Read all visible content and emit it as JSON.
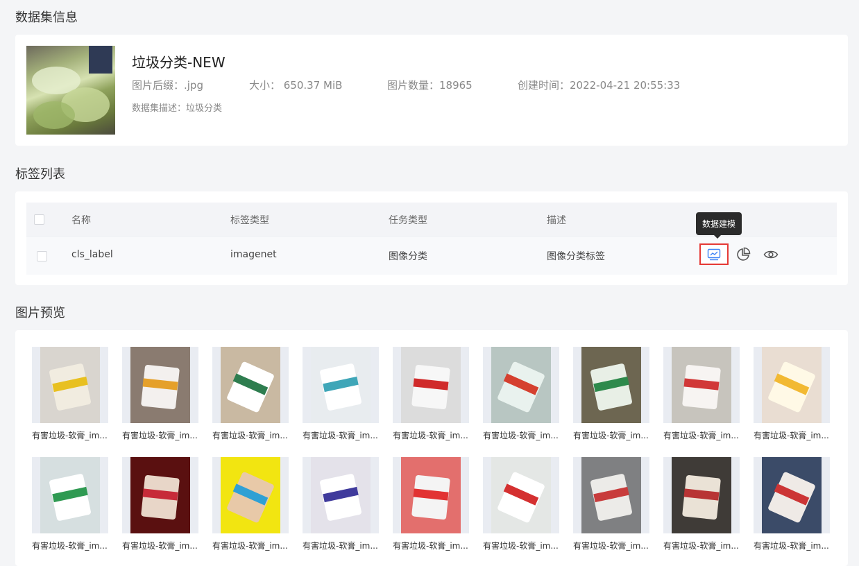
{
  "sections": {
    "info_title": "数据集信息",
    "labels_title": "标签列表",
    "preview_title": "图片预览"
  },
  "dataset": {
    "name": "垃圾分类-NEW",
    "suffix": "图片后缀：.jpg",
    "size": "大小：  650.37 MiB",
    "count": "图片数量：18965",
    "created": "创建时间：2022-04-21 20:55:33",
    "description": "数据集描述：垃圾分类"
  },
  "table": {
    "headers": [
      "名称",
      "标签类型",
      "任务类型",
      "描述"
    ],
    "row": {
      "name": "cls_label",
      "label_type": "imagenet",
      "task_type": "图像分类",
      "description": "图像分类标签"
    },
    "tooltip": "数据建模",
    "icons": [
      "chart-line-icon",
      "pie-chart-icon",
      "eye-icon"
    ]
  },
  "previews": {
    "caption": "有害垃圾-软膏_im...",
    "row1": [
      {
        "bg": "#d9d5cf",
        "fg": "#f1ece0",
        "accent": "#e8c020"
      },
      {
        "bg": "#8a7b70",
        "fg": "#f3f0ee",
        "accent": "#e5a02a"
      },
      {
        "bg": "#c9b9a2",
        "fg": "#ffffff",
        "accent": "#2e7d4f"
      },
      {
        "bg": "#e8ecef",
        "fg": "#ffffff",
        "accent": "#3fa6b8"
      },
      {
        "bg": "#dcdcdc",
        "fg": "#f7f7f7",
        "accent": "#d02a2a"
      },
      {
        "bg": "#b8c6c2",
        "fg": "#e9f2ee",
        "accent": "#d5402f"
      },
      {
        "bg": "#6d6651",
        "fg": "#e8efe6",
        "accent": "#2e8a4c"
      },
      {
        "bg": "#c7c4bd",
        "fg": "#f7f4f2",
        "accent": "#d13838"
      },
      {
        "bg": "#e9ddd2",
        "fg": "#fff9e6",
        "accent": "#f2b933"
      }
    ],
    "row2": [
      {
        "bg": "#d6dfe0",
        "fg": "#ffffff",
        "accent": "#2f9a52"
      },
      {
        "bg": "#5a1010",
        "fg": "#e8d6c8",
        "accent": "#c72b39"
      },
      {
        "bg": "#f2e511",
        "fg": "#e8c9a8",
        "accent": "#2fa0d4"
      },
      {
        "bg": "#e4e2ea",
        "fg": "#ffffff",
        "accent": "#3f3a9c"
      },
      {
        "bg": "#e36f6d",
        "fg": "#f4f4f4",
        "accent": "#e23232"
      },
      {
        "bg": "#e4e7e5",
        "fg": "#ffffff",
        "accent": "#d43030"
      },
      {
        "bg": "#7f8082",
        "fg": "#ecebe8",
        "accent": "#c83c3c"
      },
      {
        "bg": "#3f3b37",
        "fg": "#eae2d6",
        "accent": "#b83434"
      },
      {
        "bg": "#3b4b68",
        "fg": "#efeae6",
        "accent": "#cc3535"
      }
    ]
  }
}
